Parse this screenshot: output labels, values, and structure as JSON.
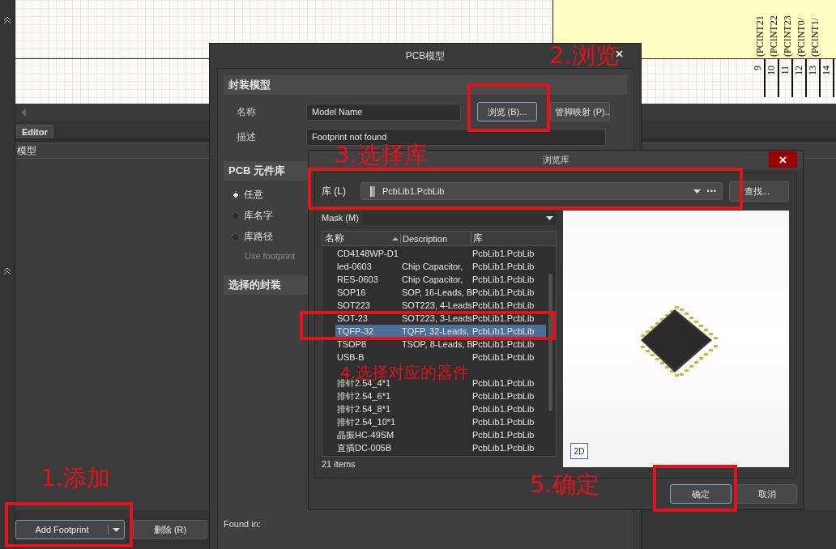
{
  "schematic": {
    "pin_labels": [
      "(PCINT21",
      "(PCINT22",
      "(PCINT23",
      "(PCINT0/",
      "(PCINT1/"
    ],
    "pin_numbers": [
      "9",
      "10",
      "11",
      "12",
      "13",
      "14"
    ]
  },
  "editor": {
    "tab": "Editor",
    "columns": [
      "模型"
    ],
    "add_button": "Add Footprint",
    "delete_button": "删除 (R)"
  },
  "pcb_model_dialog": {
    "title": "PCB模型",
    "footprint_section": "封装模型",
    "name_label": "名称",
    "name_value": "Model Name",
    "browse_button": "浏览 (B)...",
    "pin_map_button": "管脚映射 (P)..",
    "desc_label": "描述",
    "desc_value": "Footprint not found",
    "library_section": "PCB 元件库",
    "library_options": [
      {
        "label": "任意",
        "selected": true
      },
      {
        "label": "库名字",
        "selected": false
      },
      {
        "label": "库路径",
        "selected": false
      }
    ],
    "use_footprint": {
      "label": "Use footprint",
      "disabled": true
    },
    "selected_section": "选择的封装",
    "found_in": "Found in:"
  },
  "browse_dialog": {
    "title": "浏览库",
    "library_label": "库 (L)",
    "library_value": "PcbLib1.PcbLib",
    "more": "•••",
    "find_button": "查找...",
    "mask_label": "Mask (M)",
    "columns": [
      "名称",
      "Description",
      "库"
    ],
    "rows": [
      {
        "name": "CD4148WP-D1",
        "description": "",
        "library": "PcbLib1.PcbLib",
        "selected": false
      },
      {
        "name": "led-0603",
        "description": "Chip Capacitor,",
        "library": "PcbLib1.PcbLib",
        "selected": false
      },
      {
        "name": "RES-0603",
        "description": "Chip Capacitor,",
        "library": "PcbLib1.PcbLib",
        "selected": false
      },
      {
        "name": "SOP16",
        "description": "SOP, 16-Leads, B",
        "library": "PcbLib1.PcbLib",
        "selected": false
      },
      {
        "name": "SOT223",
        "description": "SOT223, 4-Leads",
        "library": "PcbLib1.PcbLib",
        "selected": false
      },
      {
        "name": "SOT-23",
        "description": "SOT223, 3-Leads",
        "library": "PcbLib1.PcbLib",
        "selected": false
      },
      {
        "name": "TQFP-32",
        "description": "TQFP, 32-Leads,",
        "library": "PcbLib1.PcbLib",
        "selected": true
      },
      {
        "name": "TSOP8",
        "description": "TSOP, 8-Leads, B",
        "library": "PcbLib1.PcbLib",
        "selected": false
      },
      {
        "name": "USB-B",
        "description": "",
        "library": "PcbLib1.PcbLib",
        "selected": false
      },
      {
        "selected": false
      },
      {
        "name": "排针2.54_4*1",
        "description": "",
        "library": "PcbLib1.PcbLib",
        "selected": false
      },
      {
        "name": "排针2.54_6*1",
        "description": "",
        "library": "PcbLib1.PcbLib",
        "selected": false
      },
      {
        "name": "排针2.54_8*1",
        "description": "",
        "library": "PcbLib1.PcbLib",
        "selected": false
      },
      {
        "name": "排针2.54_10*1",
        "description": "",
        "library": "PcbLib1.PcbLib",
        "selected": false
      },
      {
        "name": "晶振HC-49SM",
        "description": "",
        "library": "PcbLib1.PcbLib",
        "selected": false
      },
      {
        "name": "直插DC-005B",
        "description": "",
        "library": "PcbLib1.PcbLib",
        "selected": false
      }
    ],
    "count": "21 items",
    "view_button": "2D",
    "ok_button": "确定",
    "cancel_button": "取消"
  },
  "annotations": [
    {
      "text": "1.添加"
    },
    {
      "text": "2.浏览"
    },
    {
      "text": "3.选择库"
    },
    {
      "text": "4.选择对应的器件"
    },
    {
      "text": "5.确定"
    }
  ]
}
